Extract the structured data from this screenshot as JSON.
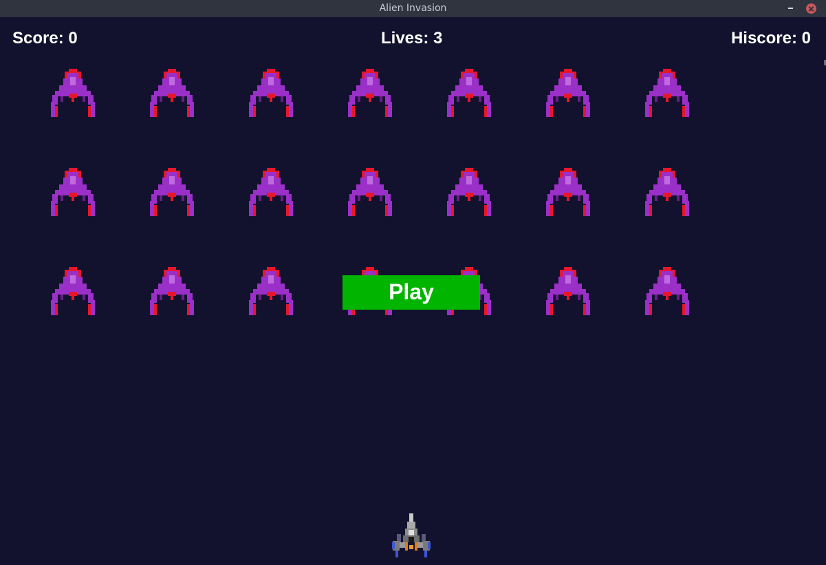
{
  "window": {
    "title": "Alien Invasion"
  },
  "hud": {
    "score": "Score: 0",
    "lives": "Lives: 3",
    "hiscore": "Hiscore: 0"
  },
  "play_button": {
    "label": "Play",
    "color": "#00b400"
  },
  "fleet": {
    "rows": 3,
    "columns": 7,
    "alien_icon": "purple-alien-icon"
  },
  "player": {
    "ship_icon": "player-ship-icon"
  },
  "colors": {
    "background": "#13122e",
    "titlebar": "#2f343f",
    "alien_body": "#9b30c8",
    "alien_accent": "#e8162a",
    "text": "#ffffff"
  }
}
